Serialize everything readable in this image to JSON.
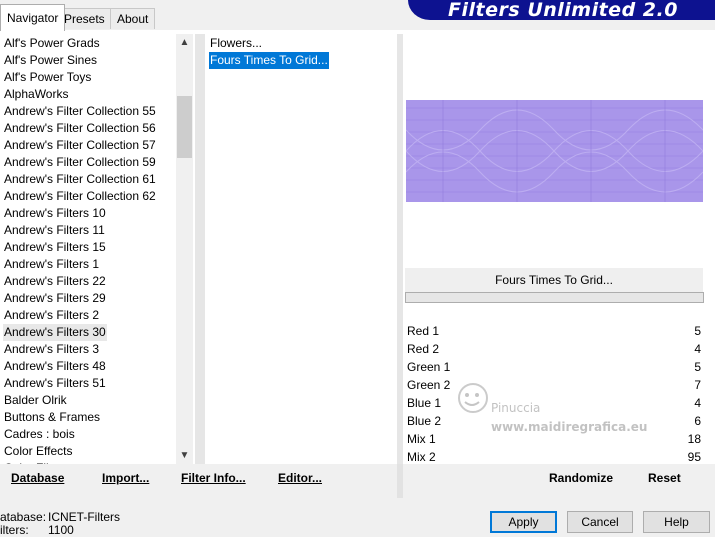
{
  "tabs": [
    "Navigator",
    "Presets",
    "About"
  ],
  "banner_title": "Filters Unlimited 2.0",
  "categories": [
    "Alf's Power Grads",
    "Alf's Power Sines",
    "Alf's Power Toys",
    "AlphaWorks",
    "Andrew's Filter Collection 55",
    "Andrew's Filter Collection 56",
    "Andrew's Filter Collection 57",
    "Andrew's Filter Collection 59",
    "Andrew's Filter Collection 61",
    "Andrew's Filter Collection 62",
    "Andrew's Filters 10",
    "Andrew's Filters 11",
    "Andrew's Filters 15",
    "Andrew's Filters 1",
    "Andrew's Filters 22",
    "Andrew's Filters 29",
    "Andrew's Filters 2",
    "Andrew's Filters 30",
    "Andrew's Filters 3",
    "Andrew's Filters 48",
    "Andrew's Filters 51",
    "Balder Olrik",
    "Buttons & Frames",
    "Cadres : bois",
    "Color Effects",
    "Color Filters"
  ],
  "selected_category": "Andrew's Filters 30",
  "filters": [
    "Flowers...",
    "Fours Times To Grid..."
  ],
  "selected_filter": "Fours Times To Grid...",
  "preview_color": "#a996ea",
  "filter_title": "Fours Times To Grid...",
  "params": [
    {
      "label": "Red 1",
      "value": "5"
    },
    {
      "label": "Red 2",
      "value": "4"
    },
    {
      "label": "Green 1",
      "value": "5"
    },
    {
      "label": "Green 2",
      "value": "7"
    },
    {
      "label": "Blue 1",
      "value": "4"
    },
    {
      "label": "Blue 2",
      "value": "6"
    },
    {
      "label": "Mix 1",
      "value": "18"
    },
    {
      "label": "Mix 2",
      "value": "95"
    }
  ],
  "bottom_buttons": {
    "database": "Database",
    "import": "Import...",
    "filter_info": "Filter Info...",
    "editor": "Editor...",
    "randomize": "Randomize",
    "reset": "Reset"
  },
  "status": {
    "database_label": "atabase:",
    "database_value": "ICNET-Filters",
    "filters_label": "ilters:",
    "filters_value": "1100"
  },
  "dialog_buttons": {
    "apply": "Apply",
    "cancel": "Cancel",
    "help": "Help"
  },
  "watermark": {
    "line1": "Pinuccia",
    "line2": "www.maidiregrafica.eu"
  }
}
